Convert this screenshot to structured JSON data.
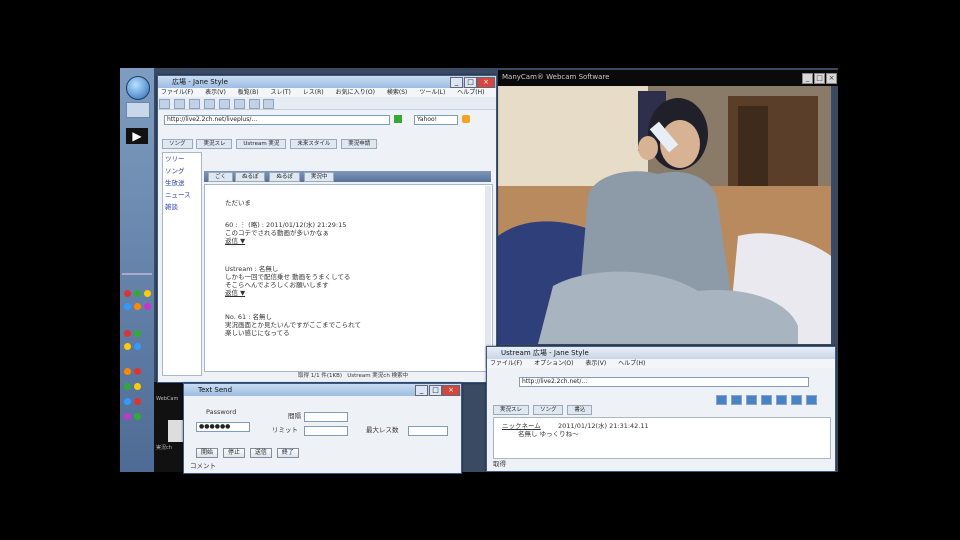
{
  "webcam_window": {
    "title": "ManyCam® Webcam Software",
    "controls": [
      "_",
      "□",
      "×"
    ]
  },
  "browser": {
    "title": "広場 - Jane Style",
    "menu": [
      "ファイル(F)",
      "表示(V)",
      "板覧(B)",
      "スレ(T)",
      "レス(R)",
      "お気に入り(O)",
      "検索(S)",
      "ツール(L)",
      "ヘルプ(H)"
    ],
    "address": "http://live2.2ch.net/liveplus/...",
    "search_placeholder": "Yahoo! ",
    "tabs_top": [
      "ソング",
      "実況スレ",
      "Ustream 実況",
      "未来スタイル",
      "実況申請"
    ],
    "thread_tabs": [
      "ごく",
      "ぬるぽ",
      "ぬるぽ",
      "実況中"
    ],
    "thread_list_items": [
      "ツリー",
      "ソング",
      "生放送",
      "ニュース",
      "雑談"
    ],
    "post_header": "ただいま",
    "posts": [
      {
        "head": "60 : ︙ (略) : 2011/01/12(水) 21:29:15",
        "body": "このコテでされる動画が多いかなぁ",
        "mail": "返信 ▼"
      },
      {
        "head": "Ustream : 名無し",
        "body": "しかも一回で配信乗せ 動画をうまくしてる\nそこらへんでよろしくお願いします",
        "mail": "返信 ▼"
      },
      {
        "head": "No. 61 : 名無し",
        "body": "実況画面とか見たいんですがここまでこられて\n楽しい感じになってる",
        "mail": ""
      }
    ],
    "status": "取得 1/1 件(1KB)   Ustream 実況ch 検索中"
  },
  "tool_dialog": {
    "title": "Text Send",
    "label1": "Password",
    "value1": "●●●●●●",
    "label2": "間隔",
    "label3": "リミット",
    "label4": "最大レス数",
    "buttons": [
      "開始",
      "停止",
      "送信",
      "終了"
    ],
    "footer": "コメント"
  },
  "bottom_window": {
    "title": "Ustream 広場 - Jane Style",
    "menu": [
      "ファイル(F)",
      "オプション(O)",
      "表示(V)",
      "ヘルプ(H)"
    ],
    "address": "http://live2.2ch.net/...",
    "tabs": [
      "実況スレ",
      "ソング",
      "書込"
    ],
    "post_name": "ニックネーム",
    "post_head": "2011/01/12(水) 21:31:42.11",
    "post_body": "名無し ゆっくりね～",
    "status": "取得"
  },
  "taskbar_labels": [
    "WebCam",
    "実況ch"
  ]
}
